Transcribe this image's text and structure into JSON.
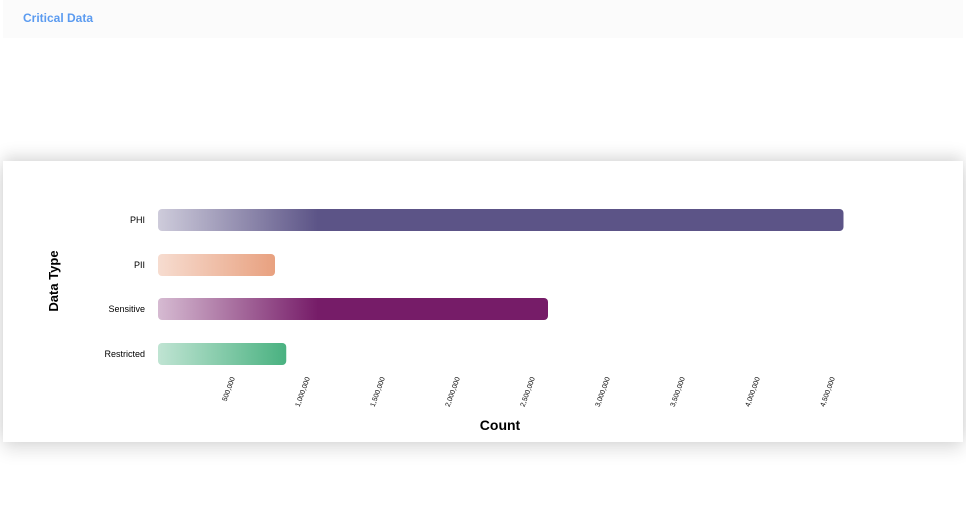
{
  "header": {
    "title": "Critical Data"
  },
  "chart_data": {
    "type": "bar",
    "orientation": "horizontal",
    "categories": [
      "PHI",
      "PII",
      "Sensitive",
      "Restricted"
    ],
    "values": [
      4570000,
      780000,
      2600000,
      855000
    ],
    "colors": [
      "#5c5487",
      "#e38b62",
      "#761c68",
      "#2ca56c"
    ],
    "xlabel": "Count",
    "ylabel": "Data Type",
    "xticks": [
      "500,000",
      "1,000,000",
      "1,500,000",
      "2,000,000",
      "2,500,000",
      "3,000,000",
      "3,500,000",
      "4,000,000",
      "4,500,000"
    ],
    "xlim": [
      0,
      4600000
    ],
    "grid": false
  }
}
